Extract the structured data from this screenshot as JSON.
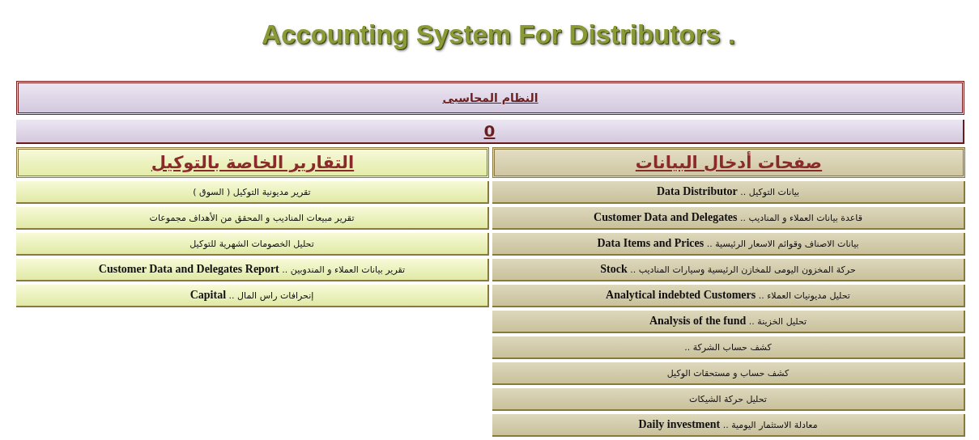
{
  "title": "Accounting System For Distributors .",
  "system_bar": {
    "label": "النظام المحاسبى"
  },
  "counter_bar": {
    "value": "0"
  },
  "data_entry": {
    "heading": "صفحات أدخال البيانات",
    "items": [
      "بيانات التوكيل .. **Data Distributor**",
      "قاعدة بيانات العملاء و المناديب .. **Customer Data and Delegates**",
      "بيانات الاصناف وقوائم الاسعار الرئيسية .. **Data Items and Prices**",
      "حركة المخزون اليومى للمخازن الرئيسية وسيارات المناديب .. **Stock**",
      "تحليل مديونيات العملاء .. **Analytical indebted Customers**",
      "تحليل الخزينة .. **Analysis of the fund**",
      "كشف حساب الشركة ..",
      "كشف حساب و مستحقات الوكيل",
      "تحليل حركة الشيكات",
      "معادلة الاستثمار اليومية  .. **Daily investment**"
    ]
  },
  "reports": {
    "heading": "التقارير الخاصة بالتوكيل",
    "items": [
      "تقرير مديونية التوكيل ( السوق )",
      "تقرير مبيعات المناديب و المحقق من الأهداف مجموعات",
      "تحليل الخصومات الشهرية للتوكيل",
      "تقرير بيانات العملاء و المندوبين .. **Customer Data and Delegates Report**",
      "إنحرافات راس المال  .. **Capital**"
    ]
  }
}
